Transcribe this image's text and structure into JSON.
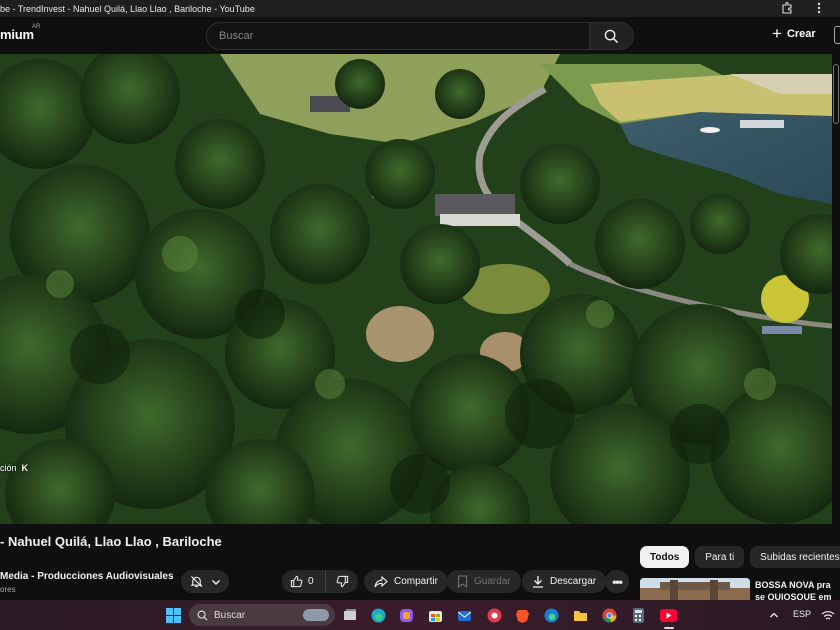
{
  "window": {
    "title": "be - TrendInvest - Nahuel Quilá, Llao Llao , Bariloche - YouTube"
  },
  "header": {
    "logo_text": "mium",
    "logo_country": "AR",
    "search_placeholder": "Buscar",
    "create_label": "Crear"
  },
  "video": {
    "overlay_text": "ción",
    "overlay_key": "K"
  },
  "video_title": "- Nahuel Quilá, Llao Llao , Bariloche",
  "channel": {
    "name": "Media - Producciones Audiovisuales",
    "subscribers": "ores"
  },
  "actions": {
    "like_count": "0",
    "share_label": "Compartir",
    "save_label": "Guardar",
    "download_label": "Descargar"
  },
  "filter_chips": [
    {
      "label": "Todos",
      "active": true
    },
    {
      "label": "Para ti",
      "active": false
    },
    {
      "label": "Subidas recientes",
      "active": false
    },
    {
      "label": "V",
      "active": false
    }
  ],
  "recommended": {
    "title": "BOSSA NOVA pra se QUIOSQUE em COPA"
  },
  "taskbar": {
    "search_label": "Buscar",
    "language": "ESP",
    "icons": [
      "windows-start-icon",
      "task-view-icon",
      "edge-icon",
      "copilot-icon",
      "store-icon",
      "mail-icon",
      "rec-icon",
      "brave-icon",
      "edge-alt-icon",
      "folder-icon",
      "chrome-icon",
      "calculator-icon",
      "youtube-icon"
    ]
  },
  "colors": {
    "background": "#0f0f0f",
    "chip": "#272727",
    "chip_active": "#f1f1f1",
    "taskbar": "#2a1a22"
  }
}
